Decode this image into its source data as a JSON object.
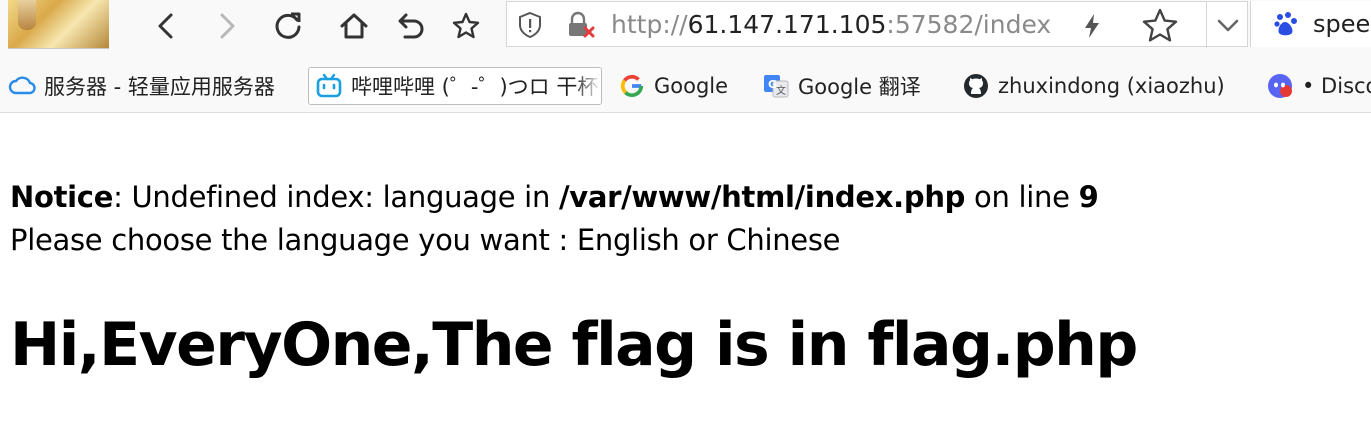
{
  "browser": {
    "nav": {
      "back_icon": "chevron-left-icon",
      "forward_icon": "chevron-right-icon",
      "reload_icon": "reload-icon",
      "home_icon": "home-icon",
      "undo_icon": "undo-icon",
      "favorite_icon": "star-icon"
    },
    "address": {
      "scheme": "http://",
      "host": "61.147.171.105",
      "rest": ":57582/index"
    },
    "search": {
      "text": "speed"
    },
    "colors": {
      "accent_blue": "#2b6fd6",
      "baidu_blue": "#2b4de3",
      "lock_warning": "#e23b3b"
    }
  },
  "bookmarks": [
    {
      "label": "服务器 - 轻量应用服务器",
      "icon": "cloud-icon"
    },
    {
      "label": "哔哩哔哩 (゜-゜)つロ 干杯",
      "icon": "bilibili-icon"
    },
    {
      "label": "Google",
      "icon": "google-icon"
    },
    {
      "label": "Google 翻译",
      "icon": "google-translate-icon"
    },
    {
      "label": "zhuxindong (xiaozhu)",
      "icon": "github-icon"
    },
    {
      "label": "• Discord",
      "icon": "discord-icon"
    }
  ],
  "page": {
    "notice": {
      "label": "Notice",
      "sep": ": Undefined index: language in ",
      "path": "/var/www/html/index.php",
      "online": " on line ",
      "line": "9"
    },
    "choose": "Please choose the language you want : English or Chinese",
    "heading": "Hi,EveryOne,The flag is in flag.php"
  }
}
